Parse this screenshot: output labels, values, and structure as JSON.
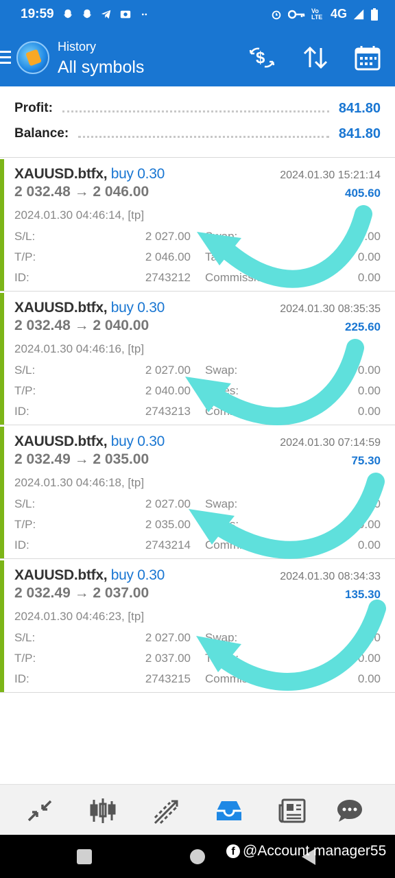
{
  "status_bar": {
    "time": "19:59",
    "network": "4G",
    "volte_label": "Vo LTE"
  },
  "app_bar": {
    "subtitle": "History",
    "title": "All symbols",
    "actions": [
      "currency-exchange-icon",
      "sort-icon",
      "calendar-icon"
    ]
  },
  "summary": {
    "profit_label": "Profit:",
    "profit_value": "841.80",
    "balance_label": "Balance:",
    "balance_value": "841.80"
  },
  "deals": [
    {
      "symbol": "XAUUSD.btfx,",
      "direction": "buy 0.30",
      "prices": "2 032.48 → 2 046.00",
      "close_time": "2024.01.30 15:21:14",
      "profit": "405.60",
      "open_time": "2024.01.30 04:46:14, [tp]",
      "sl_label": "S/L:",
      "sl": "2 027.00",
      "tp_label": "T/P:",
      "tp": "2 046.00",
      "id_label": "ID:",
      "id": "2743212",
      "swap_label": "Swap:",
      "swap": "0.00",
      "taxes_label": "Taxes:",
      "taxes": "0.00",
      "commission_label": "Commission:",
      "commission": "0.00"
    },
    {
      "symbol": "XAUUSD.btfx,",
      "direction": "buy 0.30",
      "prices": "2 032.48 → 2 040.00",
      "close_time": "2024.01.30 08:35:35",
      "profit": "225.60",
      "open_time": "2024.01.30 04:46:16, [tp]",
      "sl_label": "S/L:",
      "sl": "2 027.00",
      "tp_label": "T/P:",
      "tp": "2 040.00",
      "id_label": "ID:",
      "id": "2743213",
      "swap_label": "Swap:",
      "swap": "0.00",
      "taxes_label": "Taxes:",
      "taxes": "0.00",
      "commission_label": "Commission:",
      "commission": "0.00"
    },
    {
      "symbol": "XAUUSD.btfx,",
      "direction": "buy 0.30",
      "prices": "2 032.49 → 2 035.00",
      "close_time": "2024.01.30 07:14:59",
      "profit": "75.30",
      "open_time": "2024.01.30 04:46:18, [tp]",
      "sl_label": "S/L:",
      "sl": "2 027.00",
      "tp_label": "T/P:",
      "tp": "2 035.00",
      "id_label": "ID:",
      "id": "2743214",
      "swap_label": "Swap:",
      "swap": "0.00",
      "taxes_label": "Taxes:",
      "taxes": "0.00",
      "commission_label": "Commission:",
      "commission": "0.00"
    },
    {
      "symbol": "XAUUSD.btfx,",
      "direction": "buy 0.30",
      "prices": "2 032.49 → 2 037.00",
      "close_time": "2024.01.30 08:34:33",
      "profit": "135.30",
      "open_time": "2024.01.30 04:46:23, [tp]",
      "sl_label": "S/L:",
      "sl": "2 027.00",
      "tp_label": "T/P:",
      "tp": "2 037.00",
      "id_label": "ID:",
      "id": "2743215",
      "swap_label": "Swap:",
      "swap": "0.00",
      "taxes_label": "Taxes:",
      "taxes": "0.00",
      "commission_label": "Commission:",
      "commission": "0.00"
    }
  ],
  "bottom_nav": [
    "quotes-icon",
    "chart-icon",
    "trade-icon",
    "history-icon",
    "news-icon",
    "chat-icon"
  ],
  "colors": {
    "primary": "#1976d2",
    "profit_bar": "#7cb518",
    "annotation_arrow": "#5fe0dc"
  },
  "watermark": "@Account manager55"
}
